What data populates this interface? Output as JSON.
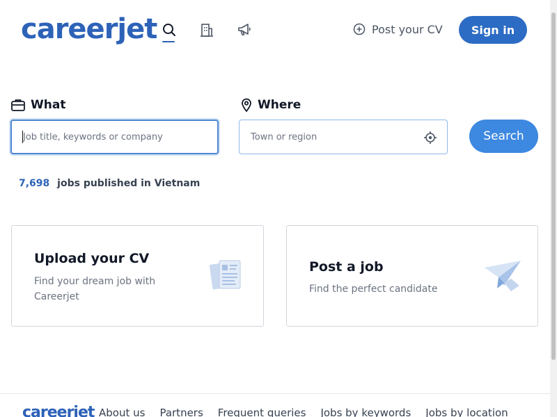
{
  "header": {
    "logo": "careerjet",
    "nav": [
      {
        "name": "search-icon",
        "active": true
      },
      {
        "name": "company-icon",
        "active": false
      },
      {
        "name": "megaphone-icon",
        "active": false
      }
    ],
    "post_cv_label": "Post your CV",
    "sign_in_label": "Sign in"
  },
  "search": {
    "what_label": "What",
    "what_placeholder": "Job title, keywords or company",
    "where_label": "Where",
    "where_placeholder": "Town or region",
    "button_label": "Search"
  },
  "stats": {
    "count": "7,698",
    "text": "jobs published in Vietnam"
  },
  "cards": {
    "upload_cv": {
      "title": "Upload your CV",
      "desc": "Find your dream job with Careerjet"
    },
    "post_job": {
      "title": "Post a job",
      "desc": "Find the perfect candidate"
    }
  },
  "footer": {
    "logo": "careerjet",
    "links": [
      "About us",
      "Partners",
      "Frequent queries",
      "Jobs by keywords",
      "Jobs by location"
    ]
  },
  "colors": {
    "brand": "#2d62b8",
    "button": "#2d6cc4",
    "search_button": "#3d88e0"
  }
}
